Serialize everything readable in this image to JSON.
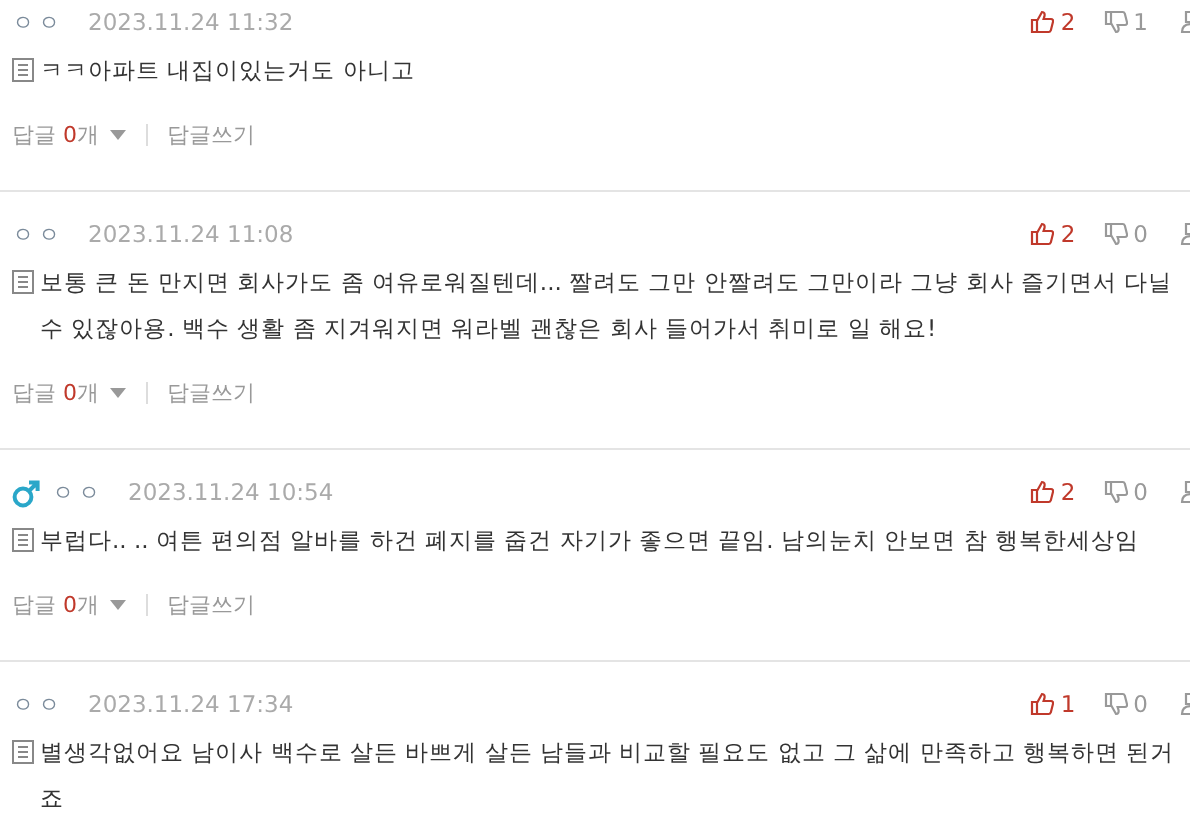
{
  "comments": [
    {
      "male": false,
      "nickname": "ㅇㅇ",
      "date": "2023.11.24 11:32",
      "likes": "2",
      "dislikes": "1",
      "text": "ㅋㅋ아파트 내집이있는거도 아니고",
      "reply_label": "답글",
      "reply_count": "0",
      "reply_unit": "개",
      "write_label": "답글쓰기"
    },
    {
      "male": false,
      "nickname": "ㅇㅇ",
      "date": "2023.11.24 11:08",
      "likes": "2",
      "dislikes": "0",
      "text": "보통 큰 돈 만지면 회사가도 좀 여유로워질텐데... 짤려도 그만 안짤려도 그만이라 그냥 회사 즐기면서 다닐 수 있잖아용. 백수 생활 좀 지겨워지면 워라벨 괜찮은 회사 들어가서 취미로 일 해요!",
      "reply_label": "답글",
      "reply_count": "0",
      "reply_unit": "개",
      "write_label": "답글쓰기"
    },
    {
      "male": true,
      "nickname": "ㅇㅇ",
      "date": "2023.11.24 10:54",
      "likes": "2",
      "dislikes": "0",
      "text": "부럽다.. .. 여튼 편의점 알바를 하건 폐지를 줍건 자기가 좋으면 끝임. 남의눈치 안보면 참 행복한세상임",
      "reply_label": "답글",
      "reply_count": "0",
      "reply_unit": "개",
      "write_label": "답글쓰기"
    },
    {
      "male": false,
      "nickname": "ㅇㅇ",
      "date": "2023.11.24 17:34",
      "likes": "1",
      "dislikes": "0",
      "text": "별생각없어요 남이사 백수로 살든 바쁘게 살든 남들과 비교할 필요도 없고 그 삶에 만족하고 행복하면 된거죠"
    }
  ]
}
